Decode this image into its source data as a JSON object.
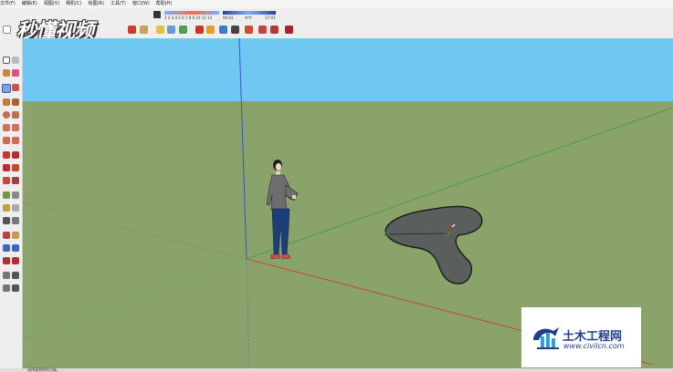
{
  "menu": {
    "items": [
      "文件(F)",
      "编辑(E)",
      "视图(V)",
      "相机(C)",
      "绘图(R)",
      "工具(T)",
      "窗口(W)",
      "帮助(H)"
    ]
  },
  "logo": {
    "text": "秒懂视频"
  },
  "shadow_panel": {
    "months": "1 2 3 4 5 6 7 8 9 10 11 12",
    "time_start": "06:03",
    "time_mid": "中午",
    "time_end": "17:03"
  },
  "watermark": {
    "cn": "土木工程网",
    "url": "www.civilcn.com"
  },
  "statusbar": {
    "text": "选择要擦除的对象。"
  },
  "colors": {
    "sky": "#6fc8f2",
    "ground": "#8aa36a",
    "blue_axis": "#3355cc",
    "green_axis": "#3aa23a",
    "red_axis": "#cc3a2a",
    "shape_fill": "#5a5e5c",
    "watermark_blue": "#1e3f8c"
  },
  "icons": {
    "toolbar": [
      "select-icon",
      "eraser-icon",
      "pencil-icon",
      "orbit-icon",
      "pan-icon",
      "zoom-icon",
      "paint-bucket-icon",
      "move-icon",
      "rotate-icon"
    ],
    "palette": [
      "select-icon",
      "component-icon",
      "paint-icon",
      "eraser-icon",
      "line-icon",
      "freehand-icon",
      "rectangle-icon",
      "circle-icon",
      "arc-icon",
      "move-icon",
      "push-pull-icon",
      "rotate-icon",
      "offset-icon",
      "tape-icon",
      "text-icon",
      "orbit-icon",
      "pan-icon",
      "zoom-icon",
      "walk-icon"
    ]
  }
}
